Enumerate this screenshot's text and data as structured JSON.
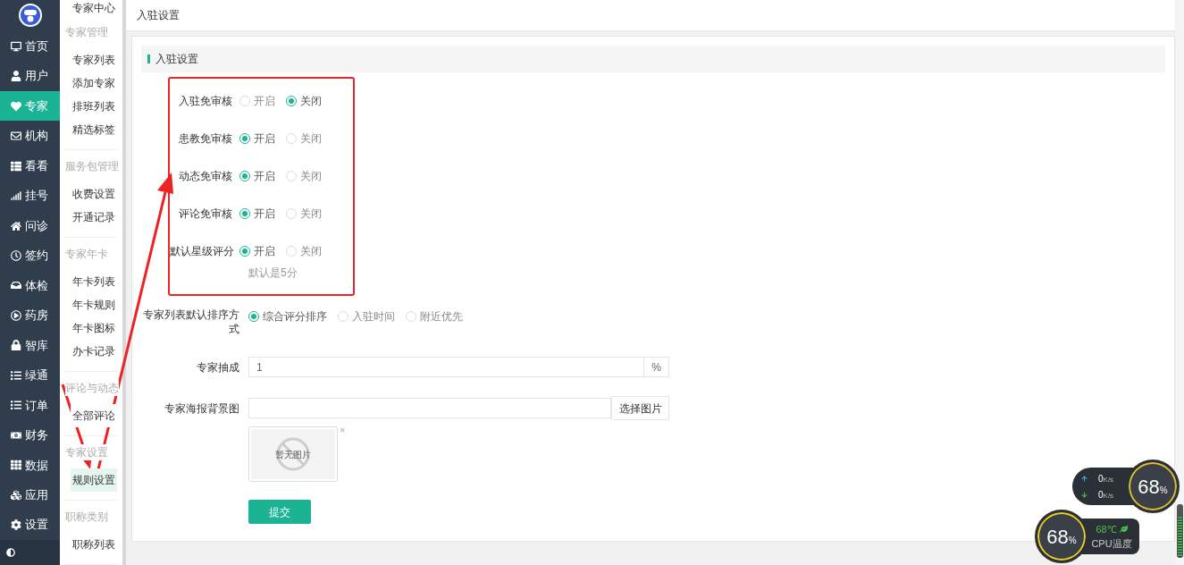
{
  "sidebar": {
    "items": [
      {
        "label": "首页",
        "selected": false
      },
      {
        "label": "用户",
        "selected": false
      },
      {
        "label": "专家",
        "selected": true
      },
      {
        "label": "机构",
        "selected": false
      },
      {
        "label": "看看",
        "selected": false
      },
      {
        "label": "挂号",
        "selected": false
      },
      {
        "label": "问诊",
        "selected": false
      },
      {
        "label": "签约",
        "selected": false
      },
      {
        "label": "体检",
        "selected": false
      },
      {
        "label": "药房",
        "selected": false
      },
      {
        "label": "智库",
        "selected": false
      },
      {
        "label": "绿通",
        "selected": false
      },
      {
        "label": "订单",
        "selected": false
      },
      {
        "label": "财务",
        "selected": false
      },
      {
        "label": "数据",
        "selected": false
      },
      {
        "label": "应用",
        "selected": false
      },
      {
        "label": "设置",
        "selected": false
      }
    ]
  },
  "submenu": {
    "title": "专家中心",
    "groups": [
      {
        "title": "专家管理",
        "items": [
          {
            "label": "专家列表",
            "selected": false
          },
          {
            "label": "添加专家",
            "selected": false
          },
          {
            "label": "排班列表",
            "selected": false
          },
          {
            "label": "精选标签",
            "selected": false
          }
        ]
      },
      {
        "title": "服务包管理",
        "items": [
          {
            "label": "收费设置",
            "selected": false
          },
          {
            "label": "开通记录",
            "selected": false
          }
        ]
      },
      {
        "title": "专家年卡",
        "items": [
          {
            "label": "年卡列表",
            "selected": false
          },
          {
            "label": "年卡规则",
            "selected": false
          },
          {
            "label": "年卡图标",
            "selected": false
          },
          {
            "label": "办卡记录",
            "selected": false
          }
        ]
      },
      {
        "title": "评论与动态",
        "items": [
          {
            "label": "全部评论",
            "selected": false
          }
        ]
      },
      {
        "title": "专家设置",
        "items": [
          {
            "label": "规则设置",
            "selected": true
          }
        ]
      },
      {
        "title": "职称类别",
        "items": [
          {
            "label": "职称列表",
            "selected": false
          }
        ]
      }
    ]
  },
  "header": {
    "title": "入驻设置"
  },
  "panel": {
    "title": "入驻设置",
    "toggles": [
      {
        "label": "入驻免审核",
        "options": [
          {
            "label": "开启",
            "selected": false
          },
          {
            "label": "关闭",
            "selected": true
          }
        ]
      },
      {
        "label": "患教免审核",
        "options": [
          {
            "label": "开启",
            "selected": true
          },
          {
            "label": "关闭",
            "selected": false
          }
        ]
      },
      {
        "label": "动态免审核",
        "options": [
          {
            "label": "开启",
            "selected": true
          },
          {
            "label": "关闭",
            "selected": false
          }
        ]
      },
      {
        "label": "评论免审核",
        "options": [
          {
            "label": "开启",
            "selected": true
          },
          {
            "label": "关闭",
            "selected": false
          }
        ]
      },
      {
        "label": "默认星级评分",
        "options": [
          {
            "label": "开启",
            "selected": true
          },
          {
            "label": "关闭",
            "selected": false
          }
        ],
        "hint": "默认是5分"
      }
    ],
    "sort": {
      "label": "专家列表默认排序方式",
      "options": [
        {
          "label": "综合评分排序",
          "selected": true
        },
        {
          "label": "入驻时间",
          "selected": false
        },
        {
          "label": "附近优先",
          "selected": false
        }
      ]
    },
    "commission": {
      "label": "专家抽成",
      "value": "1",
      "suffix": "%"
    },
    "poster": {
      "label": "专家海报背景图",
      "button": "选择图片",
      "preview_text": "暂无图片",
      "remove": "×"
    },
    "submit": "提交"
  },
  "net_monitor": {
    "up": "0",
    "up_unit": "K/s",
    "down": "0",
    "down_unit": "K/s",
    "percent": "68",
    "percent_sign": "%"
  },
  "cpu_monitor": {
    "percent": "68",
    "percent_sign": "%",
    "temperature": "68℃",
    "label": "CPU温度"
  }
}
